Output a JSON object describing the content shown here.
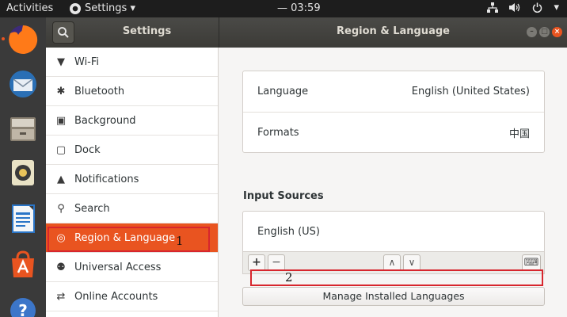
{
  "topbar": {
    "activities": "Activities",
    "app_menu": "Settings ▾",
    "clock": "— 03:59",
    "tray": {
      "network_icon": "network-icon",
      "volume_icon": "volume-icon",
      "power_icon": "power-icon",
      "chevron": "▾"
    }
  },
  "dock": [
    {
      "name": "firefox-icon",
      "color": "#e66000"
    },
    {
      "name": "thunderbird-icon",
      "color": "#2a6fb5"
    },
    {
      "name": "files-icon",
      "color": "#9a8f80"
    },
    {
      "name": "rhythmbox-icon",
      "color": "#e8c35a"
    },
    {
      "name": "writer-icon",
      "color": "#2a75c7"
    },
    {
      "name": "software-icon",
      "color": "#e95420"
    },
    {
      "name": "help-icon",
      "color": "#3c76c9"
    }
  ],
  "header": {
    "sidebar_title": "Settings",
    "window_title": "Region & Language"
  },
  "sidebar": {
    "items": [
      {
        "label": "Wi-Fi",
        "icon": "▼"
      },
      {
        "label": "Bluetooth",
        "icon": "✱"
      },
      {
        "label": "Background",
        "icon": "▣"
      },
      {
        "label": "Dock",
        "icon": "▢"
      },
      {
        "label": "Notifications",
        "icon": "▲"
      },
      {
        "label": "Search",
        "icon": "⚲"
      },
      {
        "label": "Region & Language",
        "icon": "◎"
      },
      {
        "label": "Universal Access",
        "icon": "⚉"
      },
      {
        "label": "Online Accounts",
        "icon": "⇄"
      }
    ],
    "selected_index": 6
  },
  "content": {
    "language_label": "Language",
    "language_value": "English (United States)",
    "formats_label": "Formats",
    "formats_value": "中国",
    "input_sources_label": "Input Sources",
    "input_source_item": "English (US)",
    "add_symbol": "+",
    "remove_symbol": "−",
    "up_symbol": "∧",
    "down_symbol": "∨",
    "keyboard_symbol": "⌨",
    "manage_button": "Manage Installed Languages"
  },
  "annotations": {
    "one": "1",
    "two": "2",
    "color": "#d7262d"
  },
  "colors": {
    "accent": "#e95420",
    "headerbar": "#3c3b37"
  }
}
